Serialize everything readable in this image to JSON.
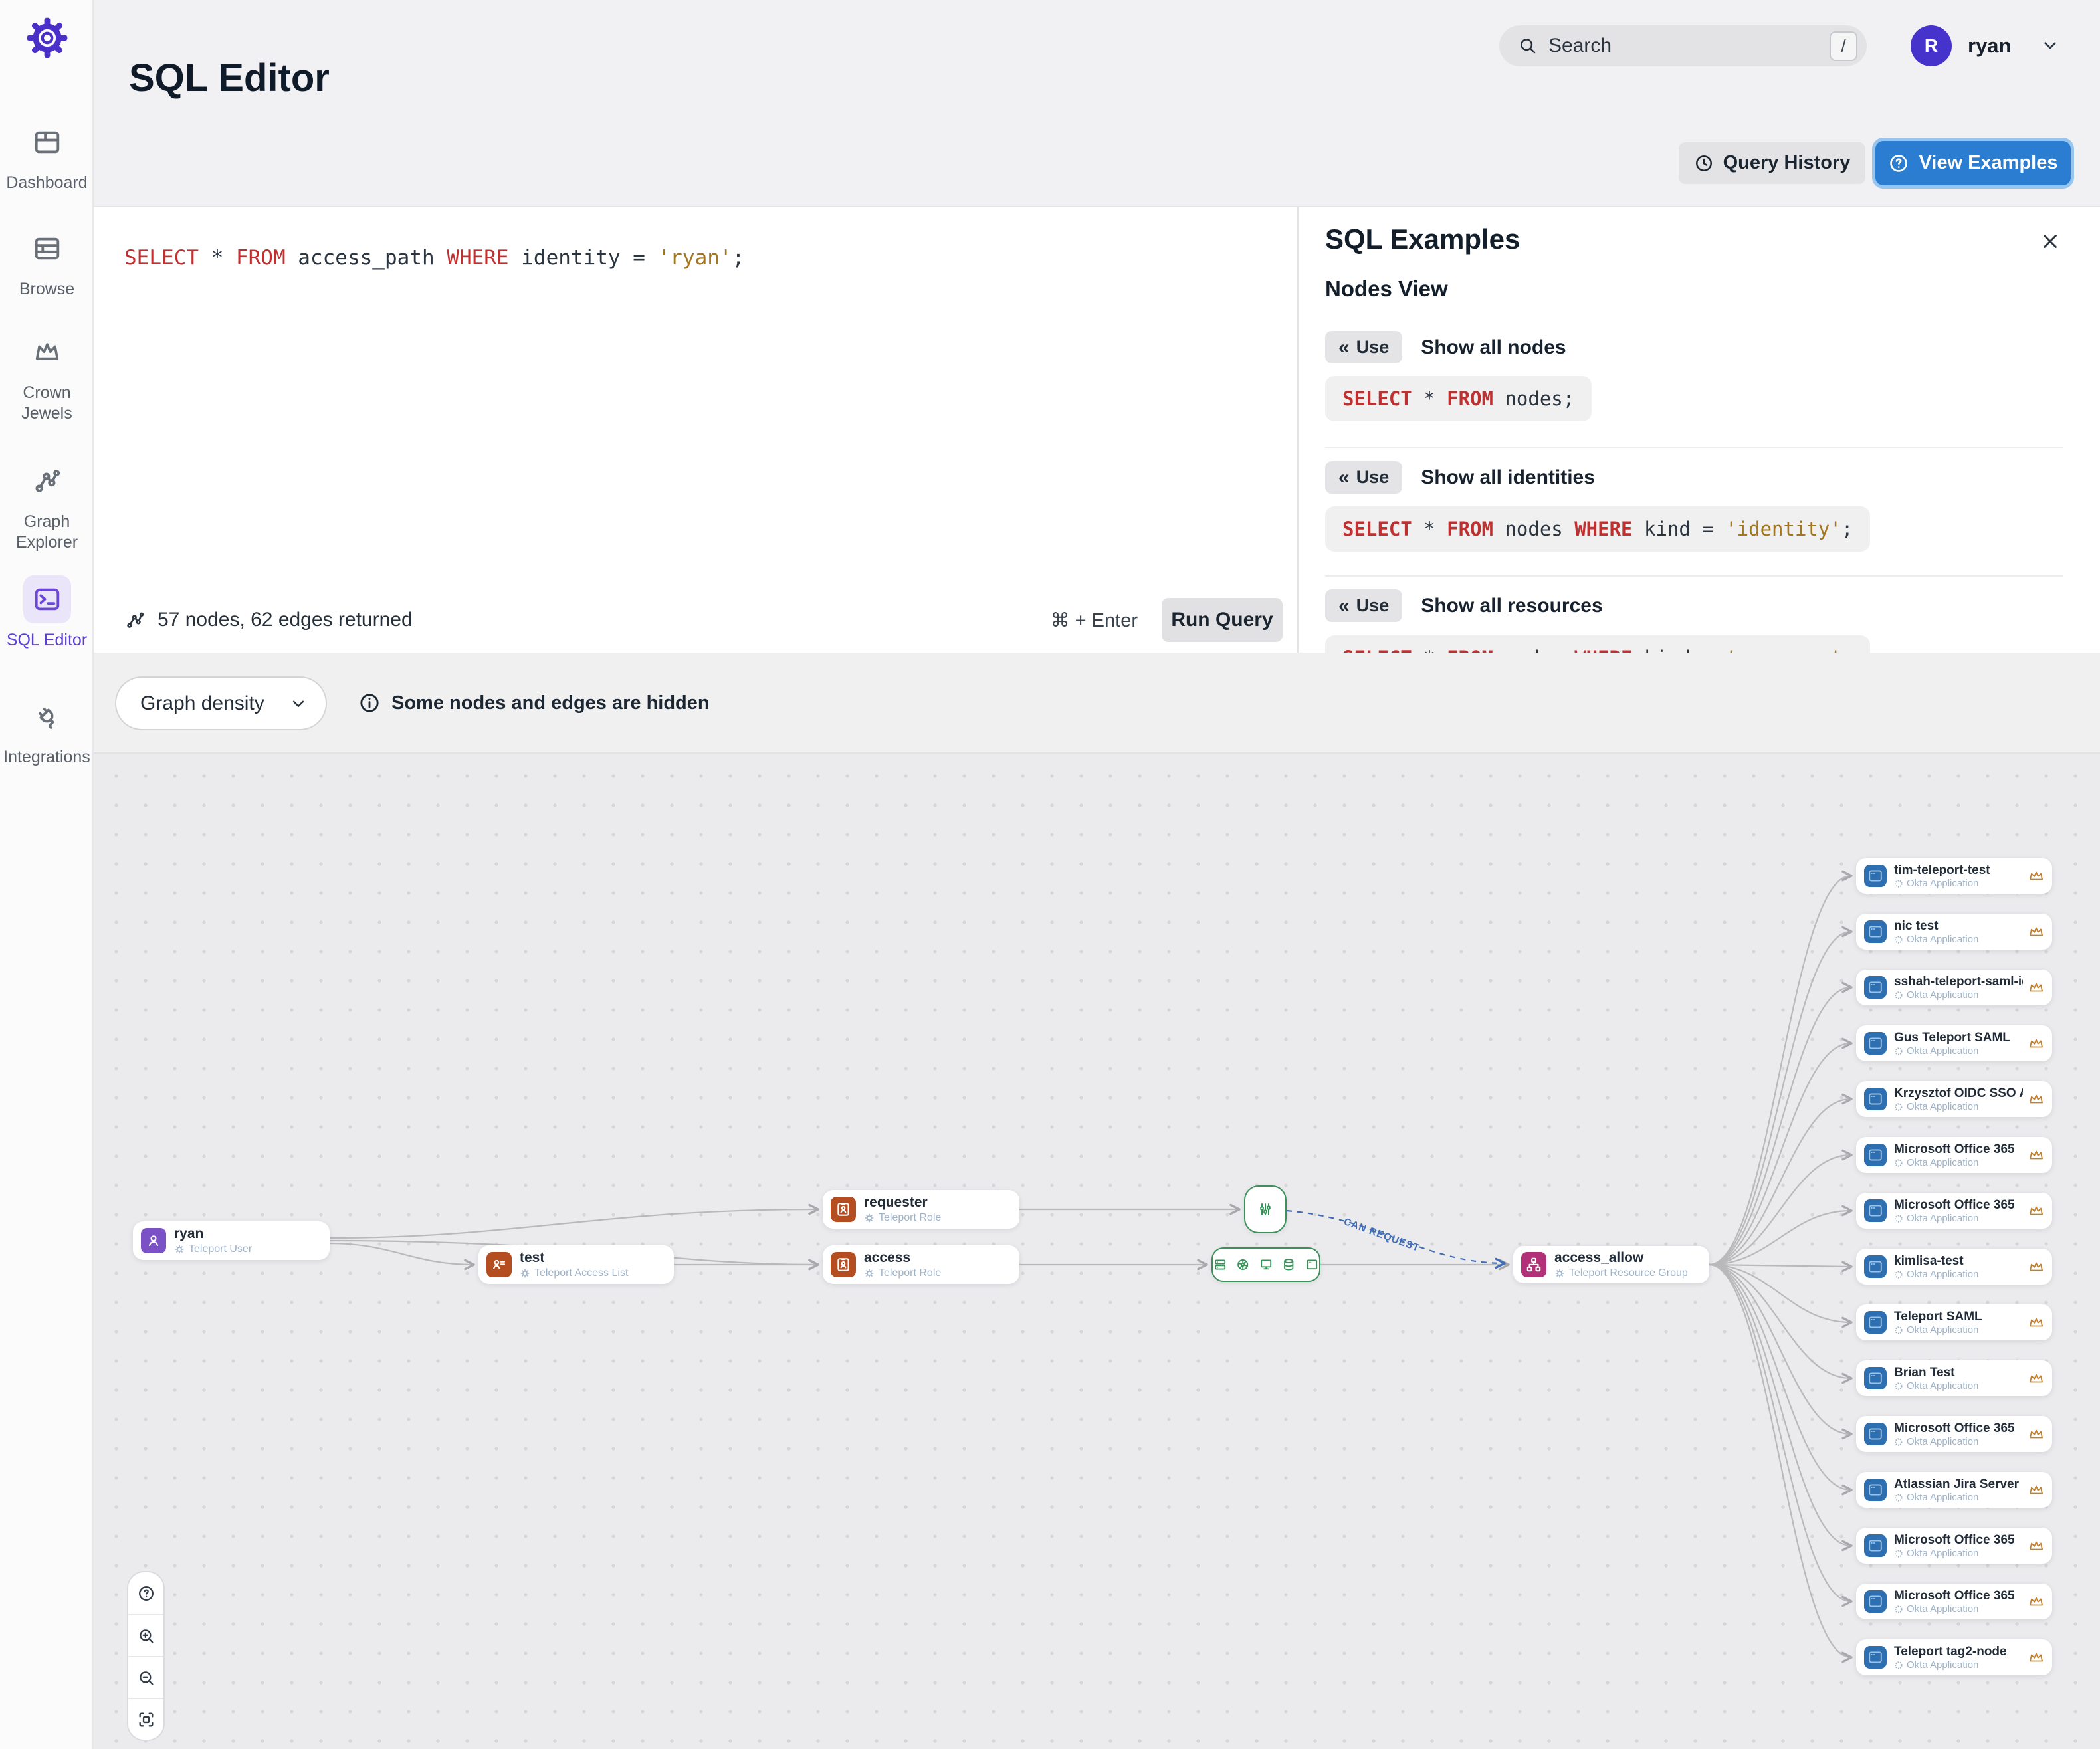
{
  "sidebar": {
    "items": [
      {
        "label": "Dashboard",
        "icon": "dashboard-icon"
      },
      {
        "label": "Browse",
        "icon": "browse-icon"
      },
      {
        "label": "Crown Jewels",
        "icon": "crown-icon"
      },
      {
        "label": "Graph Explorer",
        "icon": "graph-explorer-icon"
      },
      {
        "label": "SQL Editor",
        "icon": "terminal-icon"
      },
      {
        "label": "Integrations",
        "icon": "plug-icon"
      }
    ]
  },
  "header": {
    "title": "SQL Editor",
    "search": {
      "placeholder": "Search",
      "shortcut": "/"
    },
    "user": {
      "initial": "R",
      "name": "ryan"
    }
  },
  "actions": {
    "query_history": "Query History",
    "view_examples": "View Examples"
  },
  "editor": {
    "tokens": [
      {
        "text": "SELECT"
      },
      {
        "text": " * "
      },
      {
        "text": "FROM"
      },
      {
        "text": " access_path "
      },
      {
        "text": "WHERE"
      },
      {
        "text": " identity = "
      },
      {
        "text": "'ryan'"
      },
      {
        "text": ";"
      }
    ],
    "status": "57 nodes, 62 edges returned",
    "shortcut": "⌘ + Enter",
    "run": "Run Query"
  },
  "examples": {
    "title": "SQL Examples",
    "section": "Nodes View",
    "use_label": "Use",
    "items": [
      {
        "label": "Show all nodes",
        "code": [
          {
            "text": "SELECT"
          },
          {
            "text": " * "
          },
          {
            "text": "FROM"
          },
          {
            "text": " nodes;"
          }
        ]
      },
      {
        "label": "Show all identities",
        "code": [
          {
            "text": "SELECT"
          },
          {
            "text": " * "
          },
          {
            "text": "FROM"
          },
          {
            "text": " nodes "
          },
          {
            "text": "WHERE"
          },
          {
            "text": " kind = "
          },
          {
            "text": "'identity'"
          },
          {
            "text": ";"
          }
        ]
      },
      {
        "label": "Show all resources",
        "code": [
          {
            "text": "SELECT"
          },
          {
            "text": " * "
          },
          {
            "text": "FROM"
          },
          {
            "text": " nodes "
          },
          {
            "text": "WHERE"
          },
          {
            "text": " kind = "
          },
          {
            "text": "'resource'"
          },
          {
            "text": ";"
          }
        ]
      }
    ]
  },
  "graph": {
    "toolbar": {
      "density": "Graph density",
      "notice": "Some nodes and edges are hidden"
    },
    "edge_label": "CAN REQUEST",
    "nodes": [
      {
        "title": "ryan",
        "subtitle": "Teleport User"
      },
      {
        "title": "test",
        "subtitle": "Teleport Access List"
      },
      {
        "title": "requester",
        "subtitle": "Teleport Role"
      },
      {
        "title": "access",
        "subtitle": "Teleport Role"
      },
      {
        "title": "access_allow",
        "subtitle": "Teleport Resource Group"
      }
    ],
    "apps": [
      {
        "title": "tim-teleport-test",
        "subtitle": "Okta Application"
      },
      {
        "title": "nic test",
        "subtitle": "Okta Application"
      },
      {
        "title": "sshah-teleport-saml-idp...",
        "subtitle": "Okta Application"
      },
      {
        "title": "Gus Teleport SAML",
        "subtitle": "Okta Application"
      },
      {
        "title": "Krzysztof OIDC SSO App",
        "subtitle": "Okta Application"
      },
      {
        "title": "Microsoft Office 365",
        "subtitle": "Okta Application"
      },
      {
        "title": "Microsoft Office 365",
        "subtitle": "Okta Application"
      },
      {
        "title": "kimlisa-test",
        "subtitle": "Okta Application"
      },
      {
        "title": "Teleport SAML",
        "subtitle": "Okta Application"
      },
      {
        "title": "Brian Test",
        "subtitle": "Okta Application"
      },
      {
        "title": "Microsoft Office 365",
        "subtitle": "Okta Application"
      },
      {
        "title": "Atlassian Jira Server",
        "subtitle": "Okta Application"
      },
      {
        "title": "Microsoft Office 365",
        "subtitle": "Okta Application"
      },
      {
        "title": "Microsoft Office 365",
        "subtitle": "Okta Application"
      },
      {
        "title": "Teleport tag2-node",
        "subtitle": "Okta Application"
      }
    ]
  },
  "colors": {
    "accent_purple": "#4936c6",
    "accent_blue": "#2a7dd1",
    "keyword_red": "#bf3130",
    "string_gold": "#a3751d",
    "node_purple": "#7a52c5",
    "node_rust": "#b44d20",
    "node_magenta": "#b13077",
    "node_blue": "#2e6fb2",
    "green": "#349457",
    "edge_gray": "#b9b9b9",
    "edge_blue": "#3f6cb4",
    "crown_orange": "#c0812f"
  }
}
